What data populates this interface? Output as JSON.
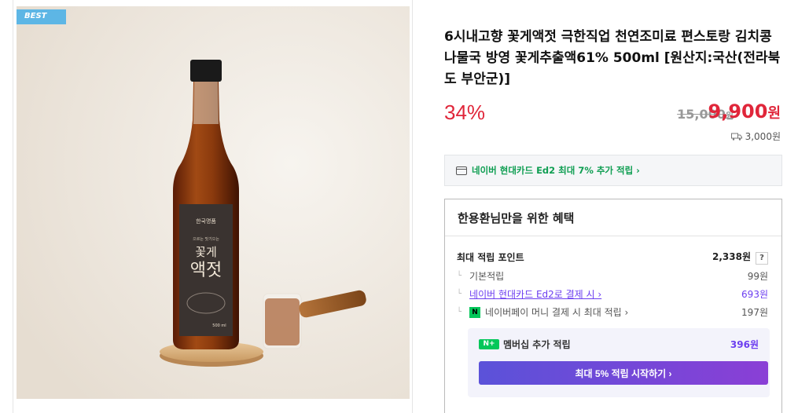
{
  "badge": "BEST",
  "product": {
    "title": "6시내고향 꽃게액젓 극한직업 천연조미료 편스토랑 김치콩나물국 방영 꽃게추출액61% 500ml [원산지:국산(전라북도 부안군)]",
    "discount": "34%",
    "old_price": "15,000",
    "old_price_unit": "원",
    "price": "9,900",
    "price_unit": "원",
    "shipping": "3,000원",
    "label_small": "으르는 맛기으는",
    "label_name_1": "꽃게",
    "label_name_2": "액젓",
    "label_volume": "500 ml",
    "brand_logo": "한국명품"
  },
  "naver_card": {
    "text": "네이버 현대카드 Ed2 최대 7% 추가 적립 ›"
  },
  "benefit": {
    "title": "한용환님만을 위한 혜택",
    "max_label": "최대 적립 포인트",
    "max_value": "2,338원",
    "q": "?",
    "rows": [
      {
        "label": "기본적립",
        "value": "99원"
      },
      {
        "label": "네이버 현대카드 Ed2로 결제 시 ›",
        "value": "693원"
      },
      {
        "label": "네이버페이 머니 결제 시 최대 적립 ›",
        "value": "197원"
      }
    ],
    "membership": {
      "badge": "N+",
      "label": "멤버십 추가 적립",
      "value": "396원",
      "button": "최대 5% 적립 시작하기 ›"
    }
  },
  "npay_icon_text": "N",
  "colors": {
    "accent": "#e0263a",
    "naver_green": "#0f9e52",
    "purple": "#6c3ef0",
    "badge": "#5db6e5"
  }
}
